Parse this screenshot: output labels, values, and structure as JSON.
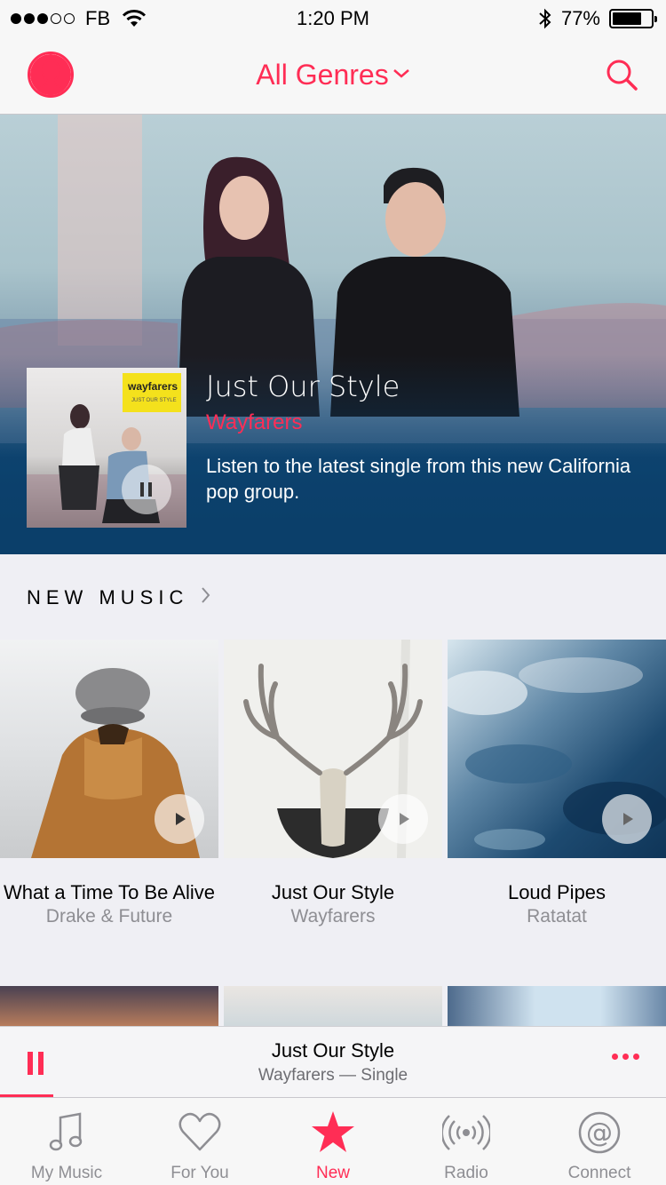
{
  "status_bar": {
    "carrier": "FB",
    "time": "1:20 PM",
    "battery": "77%",
    "battery_level": 0.77,
    "signal_bars_filled": 3,
    "signal_bars_total": 5
  },
  "header": {
    "title": "All Genres"
  },
  "hero": {
    "title": "Just Our Style",
    "artist": "Wayfarers",
    "description": "Listen to the latest single from this new California pop group.",
    "art_label": "wayfarers",
    "art_sublabel": "JUST OUR STYLE"
  },
  "new_music": {
    "section_title": "NEW MUSIC",
    "albums": [
      {
        "title": "What a Time To Be Alive",
        "artist": "Drake & Future"
      },
      {
        "title": "Just Our Style",
        "artist": "Wayfarers"
      },
      {
        "title": "Loud Pipes",
        "artist": "Ratatat"
      }
    ]
  },
  "now_playing": {
    "title": "Just Our Style",
    "subtitle": "Wayfarers — Single",
    "progress": 0.08
  },
  "tabs": [
    {
      "label": "My Music",
      "icon": "music-note-icon"
    },
    {
      "label": "For You",
      "icon": "heart-icon"
    },
    {
      "label": "New",
      "icon": "star-icon",
      "active": true
    },
    {
      "label": "Radio",
      "icon": "radio-waves-icon"
    },
    {
      "label": "Connect",
      "icon": "at-sign-icon"
    }
  ],
  "colors": {
    "accent": "#ff2d55",
    "hero_bottom": "#093d68",
    "secondary_text": "#8e8e93"
  }
}
